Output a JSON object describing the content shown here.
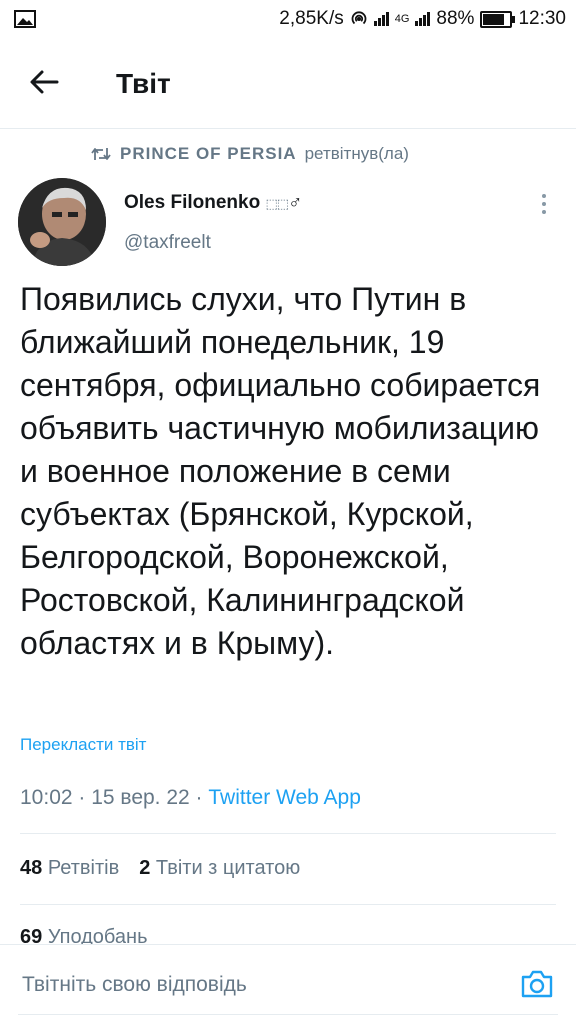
{
  "status_bar": {
    "speed": "2,85K/s",
    "network": "4G",
    "battery": "88%",
    "battery_level": 0.88,
    "time": "12:30"
  },
  "header": {
    "title": "Твіт"
  },
  "retweet": {
    "user": "PRINCE OF PERSIA",
    "action": "ретвітнув(ла)"
  },
  "author": {
    "name": "Oles Filonenko",
    "name_suffix": "♂",
    "handle": "@taxfreelt"
  },
  "tweet": {
    "text": "Появились слухи, что Путин  в ближайший понедельник, 19 сентября, официально собирается объявить частичную мобилизацию и военное положение в семи субъектах (Брянской, Курской, Белгородской, Воронежской, Ростовской, Калининградской областях и в Крыму).",
    "translate_link": "Перекласти твіт",
    "timestamp": "10:02 · 15 вер. 22 · ",
    "source_app": "Twitter Web App"
  },
  "stats": {
    "retweets_count": "48",
    "retweets_label": "Ретвітів",
    "quotes_count": "2",
    "quotes_label": "Твіти з цитатою",
    "likes_count": "69",
    "likes_label": "Уподобань"
  },
  "reply": {
    "placeholder": "Твітніть свою відповідь"
  },
  "icons": {
    "back": "arrow-left-icon",
    "retweet": "retweet-icon",
    "more": "more-vertical-icon",
    "camera": "camera-icon"
  },
  "colors": {
    "accent": "#1da1f2",
    "secondary_text": "#657786",
    "primary_text": "#14171a",
    "divider": "#e6ecf0"
  }
}
